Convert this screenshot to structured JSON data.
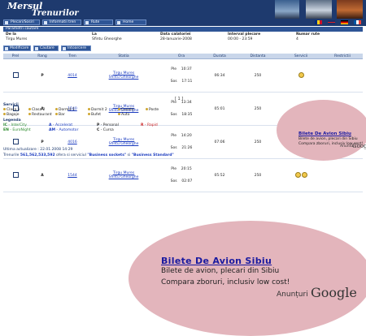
{
  "app": {
    "logo_line1": "Mersul",
    "logo_line2": "Trenurilor"
  },
  "nav": {
    "items": [
      {
        "label": "Plecari/Sosiri"
      },
      {
        "label": "Informatii tren"
      },
      {
        "label": "Rute"
      },
      {
        "label": "Home"
      }
    ],
    "flags": [
      "ro",
      "en",
      "de",
      "fr"
    ]
  },
  "search": {
    "section_title": "Parametri cautare",
    "params": [
      {
        "label": "De la",
        "value": "Tirgu Mures"
      },
      {
        "label": "La",
        "value": "Sfintu Gheorghe"
      },
      {
        "label": "Data calatoriei",
        "value": "28-Ianuarie-2008"
      },
      {
        "label": "Interval plecare",
        "value": "00:00  -  23:59"
      },
      {
        "label": "Numar rute",
        "value": "4"
      }
    ],
    "buttons": [
      {
        "label": "Modificare"
      },
      {
        "label": "Cautare"
      },
      {
        "label": "Intoarcere"
      }
    ]
  },
  "results": {
    "headers": [
      "Prel",
      "Rang",
      "Tren",
      "Statia",
      "Ora",
      "Durata",
      "Distanta",
      "Servicii",
      "Restrictii"
    ],
    "rows": [
      {
        "rang": "P",
        "tren": "4014",
        "statia_1": "Tirgu Mures",
        "statia_2": "Sfintu Gheorghe",
        "ora_1": "Ple    10:37",
        "ora_2": "Sos    17:11",
        "durata": "06:34",
        "distanta": "250",
        "servicii": 1
      },
      {
        "rang": "A",
        "tren": "1540",
        "statia_1": "Tirgu Mures",
        "statia_2": "Sfintu Gheorghe",
        "ora_1": "Ple    13:34",
        "ora_2": "Sos    18:35",
        "durata": "05:01",
        "distanta": "250",
        "servicii": 2
      },
      {
        "rang": "P",
        "tren": "4016",
        "statia_1": "Tirgu Mures",
        "statia_2": "Sfintu Gheorghe",
        "ora_1": "Ple    14:20",
        "ora_2": "Sos    21:26",
        "durata": "07:06",
        "distanta": "250",
        "servicii": 1
      },
      {
        "rang": "A",
        "tren": "1544",
        "statia_1": "Tirgu Mures",
        "statia_2": "Sfintu Gheorghe",
        "ora_1": "Ple    20:15",
        "ora_2": "Sos    02:07",
        "durata": "05:52",
        "distanta": "250",
        "servicii": 2
      }
    ],
    "pager": "[ 1 ]"
  },
  "services_legend": {
    "title": "Servicii",
    "items": [
      "Clasa 1",
      "Clasa 2",
      "Dormit 1",
      "Dormit 2",
      "Cusete",
      "Poste",
      "Bagaje",
      "Restaurant",
      "Bar",
      "Bufet",
      "Auto"
    ]
  },
  "legend": {
    "title": "Legenda",
    "items": [
      {
        "code": "IC",
        "text": "- InterCity"
      },
      {
        "code": "A",
        "text": "- Accelerat"
      },
      {
        "code": "P",
        "text": "- Personal"
      },
      {
        "code": "R",
        "text": "- Rapid"
      },
      {
        "code": "EN",
        "text": "- EuroNight"
      },
      {
        "code": "AM",
        "text": "- Automotor"
      },
      {
        "code": "C",
        "text": "- Cursa"
      }
    ]
  },
  "footer": {
    "updated": "Ultima actualizare : 22.01.2008 14:29",
    "note_prefix": "Trenurile ",
    "note_highlight": "561,562,533,592",
    "note_middle": " ofera si serviciul ",
    "service_1": "\"Business sockets\"",
    "note_and": " si ",
    "service_2": "\"Business Standard\""
  },
  "ad_small": {
    "title": "Bilete De Avion Sibiu",
    "line1": "Bilete de avion, plecari din Sibiu",
    "line2": "Compara zboruri, inclusiv low cost!",
    "by": "Anunturi",
    "brand": "Google"
  },
  "ad_large": {
    "title": "Bilete De Avion Sibiu",
    "line1": "Bilete de avion, plecari din Sibiu",
    "line2": "Compara zboruri, inclusiv low cost!",
    "by": "Anunțuri",
    "brand": "Google"
  }
}
